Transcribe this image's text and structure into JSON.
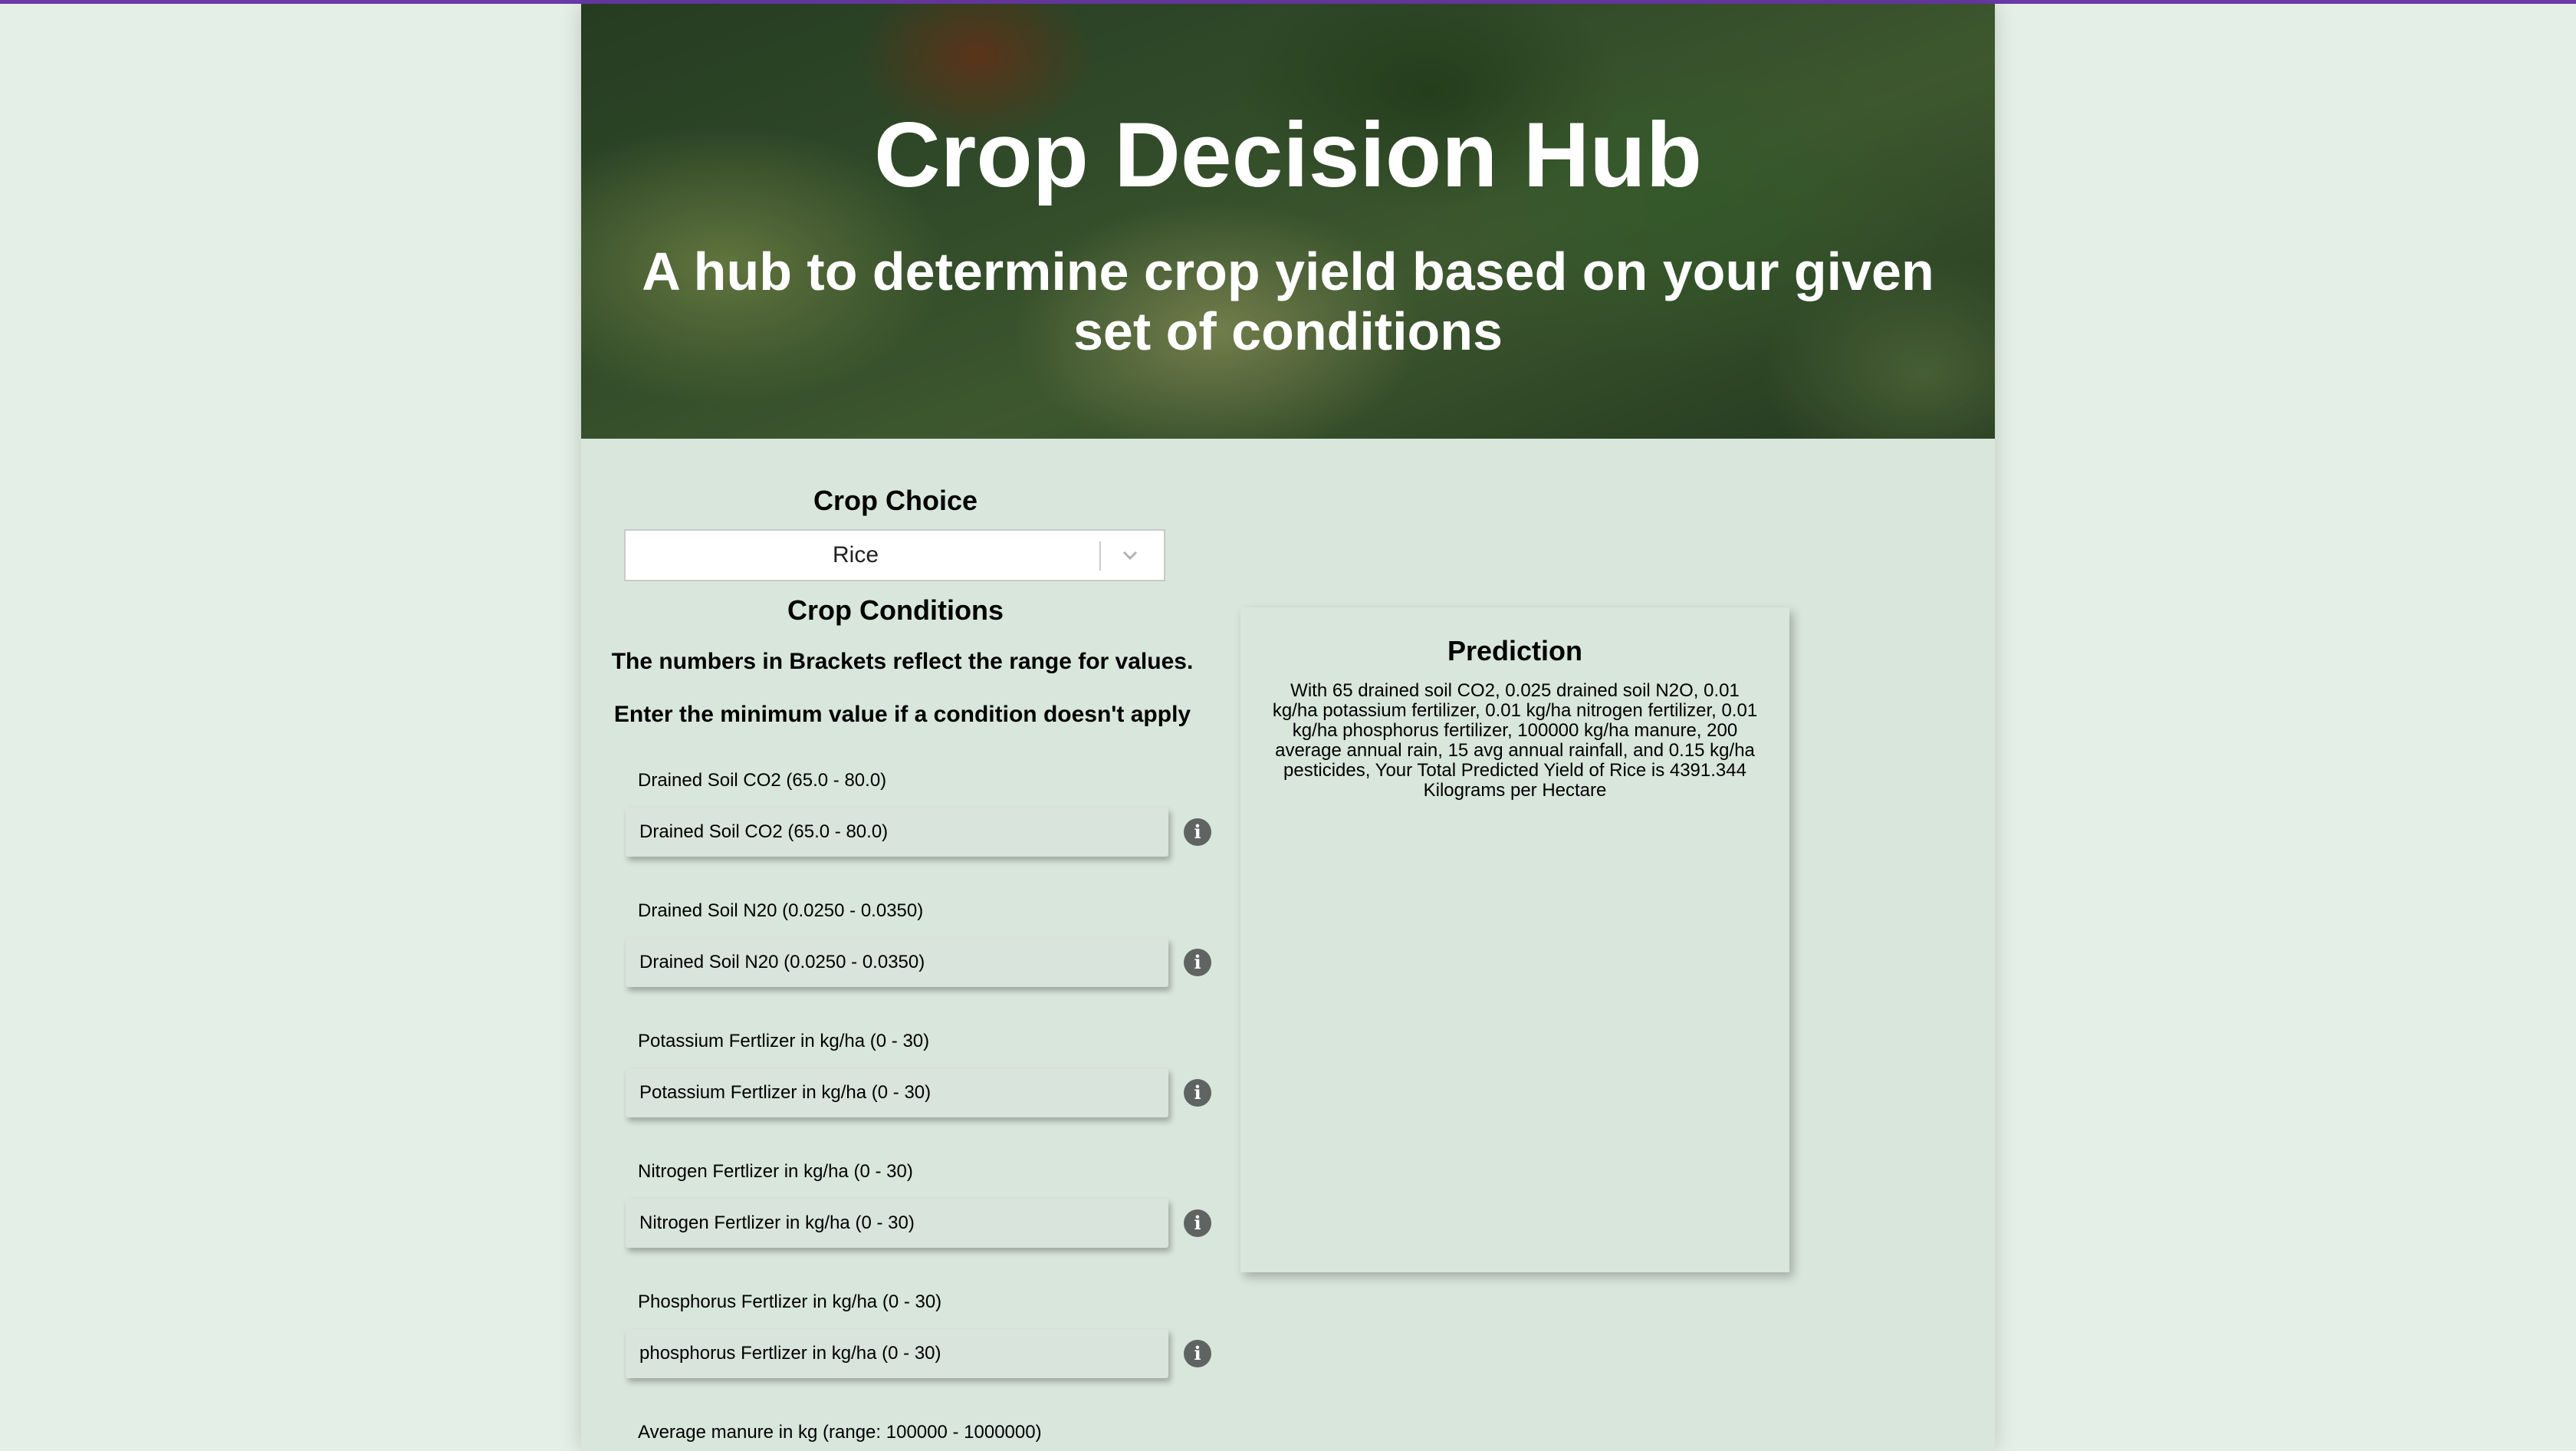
{
  "header": {
    "title": "Crop Decision Hub",
    "subtitle": "A hub to determine crop yield based on your given set of conditions"
  },
  "crop_choice": {
    "title": "Crop Choice",
    "selected": "Rice"
  },
  "conditions": {
    "title": "Crop Conditions",
    "note1": "The numbers in Brackets reflect the range for values.",
    "note2": "Enter the minimum value if a condition doesn't apply",
    "fields": [
      {
        "label": "Drained Soil CO2 (65.0 - 80.0)",
        "placeholder": "Drained Soil CO2 (65.0 - 80.0)"
      },
      {
        "label": "Drained Soil N20 (0.0250 - 0.0350)",
        "placeholder": "Drained Soil N20 (0.0250 - 0.0350)"
      },
      {
        "label": "Potassium Fertlizer in kg/ha (0 - 30)",
        "placeholder": "Potassium Fertlizer in kg/ha (0 - 30)"
      },
      {
        "label": "Nitrogen Fertlizer in kg/ha (0 - 30)",
        "placeholder": "Nitrogen Fertlizer in kg/ha (0 - 30)"
      },
      {
        "label": "Phosphorus Fertlizer in kg/ha (0 - 30)",
        "placeholder": "phosphorus Fertlizer in kg/ha (0 - 30)"
      },
      {
        "label": "Average manure in kg (range: 100000 - 1000000)"
      }
    ]
  },
  "prediction": {
    "title": "Prediction",
    "text": "With 65 drained soil CO2, 0.025 drained soil N2O, 0.01 kg/ha potassium fertilizer, 0.01 kg/ha nitrogen fertilizer, 0.01 kg/ha phosphorus fertilizer, 100000 kg/ha manure, 200 average annual rain, 15 avg annual rainfall, and 0.15 kg/ha pesticides, Your Total Predicted Yield of Rice is 4391.344 Kilograms per Hectare"
  },
  "colors": {
    "page_bg": "#e4f0e7",
    "card_bg": "#d8e6dc",
    "top_accent": "#6b3aa8",
    "info_icon": "#5f6462"
  },
  "icons": [
    "chevron-down-icon",
    "info-icon"
  ]
}
